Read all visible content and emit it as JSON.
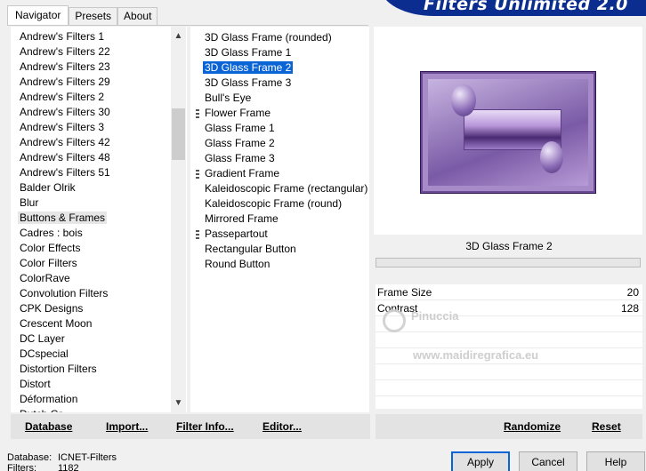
{
  "banner": {
    "title": "Filters Unlimited 2.0"
  },
  "tabs": [
    {
      "label": "Navigator",
      "active": true
    },
    {
      "label": "Presets",
      "active": false
    },
    {
      "label": "About",
      "active": false
    }
  ],
  "categories": [
    "Andrew's Filters 1",
    "Andrew's Filters 22",
    "Andrew's Filters 23",
    "Andrew's Filters 29",
    "Andrew's Filters 2",
    "Andrew's Filters 30",
    "Andrew's Filters 3",
    "Andrew's Filters 42",
    "Andrew's Filters 48",
    "Andrew's Filters 51",
    "Balder Olrik",
    "Blur",
    "Buttons & Frames",
    "Cadres : bois",
    "Color Effects",
    "Color Filters",
    "ColorRave",
    "Convolution Filters",
    "CPK Designs",
    "Crescent Moon",
    "DC Layer",
    "DCspecial",
    "Distortion Filters",
    "Distort",
    "Déformation",
    "Dutch Gr..."
  ],
  "selected_category": "Buttons & Frames",
  "filters": [
    {
      "label": "3D Glass Frame (rounded)",
      "folder": false
    },
    {
      "label": "3D Glass Frame 1",
      "folder": false
    },
    {
      "label": "3D Glass Frame 2",
      "folder": false
    },
    {
      "label": "3D Glass Frame 3",
      "folder": false
    },
    {
      "label": "Bull's Eye",
      "folder": false
    },
    {
      "label": "Flower Frame",
      "folder": true
    },
    {
      "label": "Glass Frame 1",
      "folder": false
    },
    {
      "label": "Glass Frame 2",
      "folder": false
    },
    {
      "label": "Glass Frame 3",
      "folder": false
    },
    {
      "label": "Gradient Frame",
      "folder": true
    },
    {
      "label": "Kaleidoscopic Frame (rectangular)",
      "folder": false
    },
    {
      "label": "Kaleidoscopic Frame (round)",
      "folder": false
    },
    {
      "label": "Mirrored Frame",
      "folder": false
    },
    {
      "label": "Passepartout",
      "folder": true
    },
    {
      "label": "Rectangular Button",
      "folder": false
    },
    {
      "label": "Round Button",
      "folder": false
    }
  ],
  "selected_filter": "3D Glass Frame 2",
  "preview": {
    "filter_title": "3D Glass Frame 2"
  },
  "params": [
    {
      "name": "Frame Size",
      "value": "20"
    },
    {
      "name": "Contrast",
      "value": "128"
    }
  ],
  "watermark": {
    "name": "Pinuccia",
    "url": "www.maidiregrafica.eu"
  },
  "left_buttons": {
    "database": "Database",
    "import": "Import...",
    "filter_info": "Filter Info...",
    "editor": "Editor..."
  },
  "right_buttons": {
    "randomize": "Randomize",
    "reset": "Reset"
  },
  "status": {
    "database_label": "Database:",
    "database_value": "ICNET-Filters",
    "filters_label": "Filters:",
    "filters_value": "1182"
  },
  "dialog_buttons": {
    "apply": "Apply",
    "cancel": "Cancel",
    "help": "Help"
  },
  "colors": {
    "selection": "#0a64d6",
    "banner": "#0b2d8f",
    "accent": "#a78ac8"
  }
}
